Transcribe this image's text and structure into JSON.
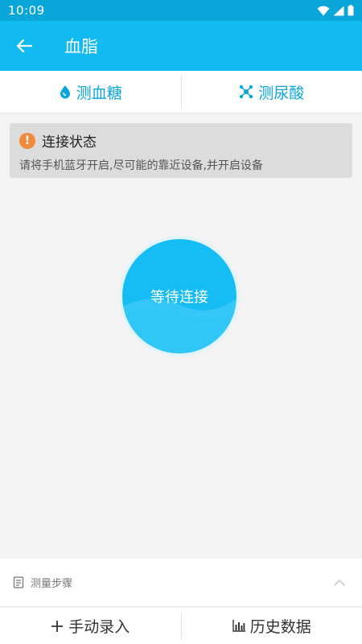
{
  "status_bar": {
    "time": "10:09"
  },
  "app_bar": {
    "title": "血脂"
  },
  "tabs": [
    {
      "label": "测血糖",
      "icon": "drop-icon"
    },
    {
      "label": "测尿酸",
      "icon": "molecule-icon"
    }
  ],
  "notice": {
    "title": "连接状态",
    "message": "请将手机蓝牙开启,尽可能的靠近设备,并开启设备"
  },
  "connect": {
    "label": "等待连接"
  },
  "steps": {
    "label": "测量步骤"
  },
  "bottom": {
    "manual_label": "手动录入",
    "history_label": "历史数据"
  },
  "colors": {
    "accent": "#12baf2",
    "statusbar": "#0aa6d9",
    "warning": "#f08a3a"
  }
}
